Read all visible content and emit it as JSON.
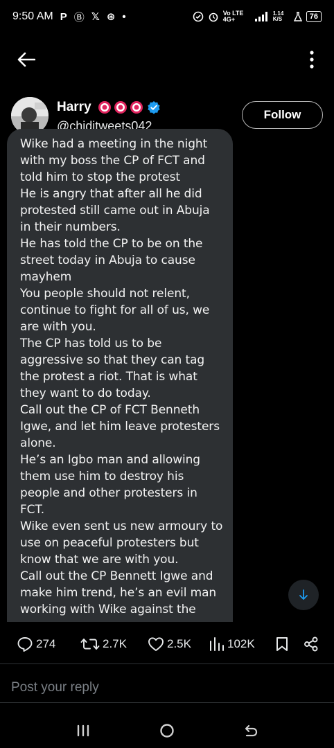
{
  "status_bar": {
    "time": "9:50 AM",
    "app_icons": [
      "P",
      "Ⓑ",
      "𝕏",
      "⊛",
      "•"
    ],
    "network": "Vo LTE 4G+",
    "speed": "1.14 K/S",
    "battery": "76"
  },
  "author": {
    "name": "Harry",
    "handle": "@chiditweets042",
    "follow_label": "Follow"
  },
  "post": {
    "text": "Wike had a meeting in the night\nwith my boss the CP of FCT and\ntold him to stop the protest\nHe is angry that after all he did\nprotested still came out in Abuja\nin their numbers.\nHe has told the CP to be on the\nstreet today in Abuja to cause\nmayhem\nYou people should not relent,\ncontinue to fight for all of us, we\nare with you.\nThe CP has told us to be\naggressive so that they can tag\nthe protest a riot. That is what\nthey want to do today.\nCall out the CP of FCT Benneth\nIgwe, and let him leave protesters\nalone.\nHe’s an Igbo man and allowing\nthem use him to destroy his\npeople and other protesters in\nFCT.\nWike even sent us new armoury to\nuse on peaceful protesters but\nknow that we are with you.\nCall out the CP Bennett Igwe and\nmake him trend, he’s an evil man\nworking with Wike against the"
  },
  "actions": {
    "replies": "274",
    "reposts": "2.7K",
    "likes": "2.5K",
    "views": "102K"
  },
  "reply": {
    "placeholder": "Post your reply"
  },
  "colors": {
    "background": "#000000",
    "card": "#2d3033",
    "accent": "#1d9bf0",
    "badge_red": "#e0245e"
  }
}
